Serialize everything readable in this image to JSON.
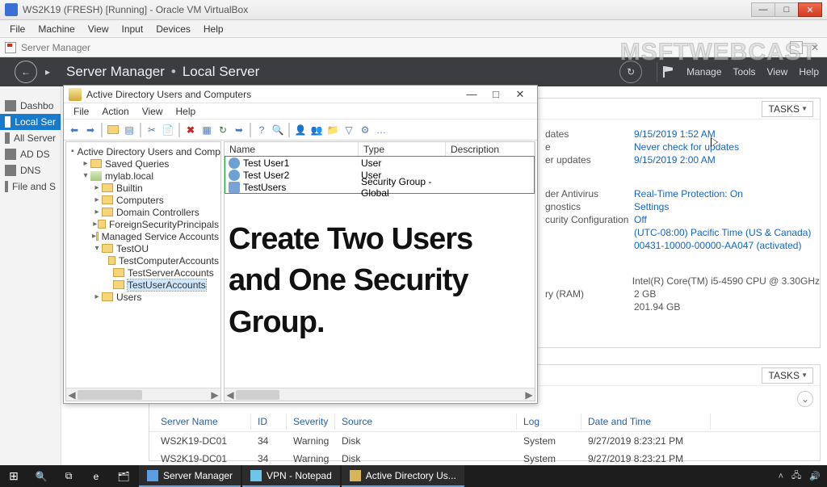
{
  "vb": {
    "title": "WS2K19 (FRESH) [Running] - Oracle VM VirtualBox",
    "menu": [
      "File",
      "Machine",
      "View",
      "Input",
      "Devices",
      "Help"
    ]
  },
  "sm_window": {
    "title": "Server Manager"
  },
  "sm_header": {
    "app": "Server Manager",
    "section": "Local Server",
    "menu": [
      "Manage",
      "Tools",
      "View",
      "Help"
    ]
  },
  "sm_nav": {
    "items": [
      {
        "label": "Dashbo",
        "selected": false
      },
      {
        "label": "Local Ser",
        "selected": true
      },
      {
        "label": "All Server",
        "selected": false
      },
      {
        "label": "AD DS",
        "selected": false
      },
      {
        "label": "DNS",
        "selected": false
      },
      {
        "label": "File and S",
        "selected": false
      }
    ]
  },
  "tasks_label": "TASKS",
  "props": {
    "rows1": [
      {
        "label": "dates",
        "value": "9/15/2019 1:52 AM"
      },
      {
        "label": "e",
        "value": "Never check for updates"
      },
      {
        "label": "er updates",
        "value": "9/15/2019 2:00 AM"
      }
    ],
    "rows2": [
      {
        "label": "der Antivirus",
        "value": "Real-Time Protection: On"
      },
      {
        "label": "gnostics",
        "value": "Settings"
      },
      {
        "label": "curity Configuration",
        "value": "Off"
      },
      {
        "label": "",
        "value": "(UTC-08:00) Pacific Time (US & Canada)"
      },
      {
        "label": "",
        "value": "00431-10000-00000-AA047 (activated)"
      }
    ],
    "sys": [
      {
        "label": "",
        "value": "Intel(R) Core(TM) i5-4590 CPU @ 3.30GHz"
      },
      {
        "label": "ry (RAM)",
        "value": "2 GB"
      },
      {
        "label": "",
        "value": "201.94 GB"
      }
    ]
  },
  "events": {
    "headers": {
      "server": "Server Name",
      "id": "ID",
      "sev": "Severity",
      "src": "Source",
      "log": "Log",
      "dt": "Date and Time"
    },
    "rows": [
      {
        "server": "WS2K19-DC01",
        "id": "34",
        "sev": "Warning",
        "src": "Disk",
        "log": "System",
        "dt": "9/27/2019 8:23:21 PM"
      },
      {
        "server": "WS2K19-DC01",
        "id": "34",
        "sev": "Warning",
        "src": "Disk",
        "log": "System",
        "dt": "9/27/2019 8:23:21 PM"
      }
    ]
  },
  "aduc": {
    "title": "Active Directory Users and Computers",
    "menu": [
      "File",
      "Action",
      "View",
      "Help"
    ],
    "tree": {
      "root": "Active Directory Users and Computers [W",
      "saved": "Saved Queries",
      "domain": "mylab.local",
      "children": [
        "Builtin",
        "Computers",
        "Domain Controllers",
        "ForeignSecurityPrincipals",
        "Managed Service Accounts"
      ],
      "test_ou": "TestOU",
      "test_children": [
        "TestComputerAccounts",
        "TestServerAccounts",
        "TestUserAccounts"
      ],
      "users": "Users"
    },
    "list_head": {
      "name": "Name",
      "type": "Type",
      "desc": "Description"
    },
    "items": [
      {
        "name": "Test User1",
        "type": "User"
      },
      {
        "name": "Test User2",
        "type": "User"
      },
      {
        "name": "TestUsers",
        "type": "Security Group - Global"
      }
    ],
    "overlay": "Create Two Users and One Security Group."
  },
  "watermark": "MSFTWEBCAST",
  "taskbar": {
    "items": [
      {
        "label": "Server Manager"
      },
      {
        "label": "VPN - Notepad"
      },
      {
        "label": "Active Directory Us..."
      }
    ]
  }
}
